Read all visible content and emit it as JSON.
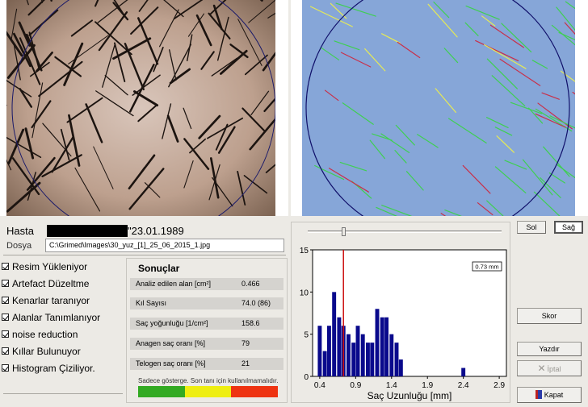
{
  "patient": {
    "label": "Hasta",
    "dob": "\"23.01.1989",
    "file_label": "Dosya",
    "file_path": "C:\\Grimed\\Images\\30_yuz_[1]_25_06_2015_1.jpg"
  },
  "steps": [
    "Resim Yükleniyor",
    "Artefact Düzeltme",
    "Kenarlar taranıyor",
    "Alanlar Tanımlanıyor",
    "noise reduction",
    "Kıllar Bulunuyor",
    "Histogram Çiziliyor."
  ],
  "results": {
    "title": "Sonuçlar",
    "rows": [
      {
        "label": "Analiz edilen alan [cm²]",
        "value": "0.466"
      },
      {
        "label": "Kıl Sayısı",
        "value": "74.0 (86)"
      },
      {
        "label": "Saç yoğunluğu [1/cm²]",
        "value": "158.6"
      },
      {
        "label": "Anagen saç oranı [%]",
        "value": "79"
      },
      {
        "label": "Telogen saç oranı [%]",
        "value": "21"
      }
    ],
    "warning": "Sadece gösterge. Son tanı için kullanılmamalıdır.",
    "scale_colors": [
      "#33aa22",
      "#eeee11",
      "#ee3311"
    ]
  },
  "buttons": {
    "sol": "Sol",
    "sag": "Sağ",
    "skor": "Skor",
    "yazdir": "Yazdır",
    "iptal": "İptal",
    "kapat": "Kapat"
  },
  "chart_data": {
    "type": "bar",
    "xlabel": "Saç Uzunluğu [mm]",
    "ylabel": "",
    "xlim": [
      0.3,
      3.0
    ],
    "ylim": [
      0,
      15
    ],
    "xticks": [
      "0.4",
      "0.9",
      "1.4",
      "1.9",
      "2.4",
      "2.9"
    ],
    "yticks": [
      "0",
      "5",
      "10",
      "15"
    ],
    "bin_width": 0.0667,
    "x": [
      0.4,
      0.47,
      0.53,
      0.6,
      0.67,
      0.73,
      0.8,
      0.87,
      0.93,
      1.0,
      1.07,
      1.13,
      1.2,
      1.27,
      1.33,
      1.4,
      1.47,
      1.53,
      1.6,
      1.67,
      1.73,
      1.8,
      1.87,
      1.93,
      2.0,
      2.07,
      2.13,
      2.2,
      2.27,
      2.33,
      2.4
    ],
    "values": [
      6,
      3,
      6,
      10,
      7,
      6,
      5,
      4,
      6,
      5,
      4,
      4,
      8,
      7,
      7,
      5,
      4,
      2,
      0,
      0,
      0,
      0,
      0,
      0,
      0,
      0,
      0,
      0,
      0,
      0,
      1
    ],
    "bar_color": "#0a0a8c",
    "marker_x": 0.73,
    "marker_color": "#cc1111",
    "marker_label": "0.73 mm",
    "grid": false
  }
}
